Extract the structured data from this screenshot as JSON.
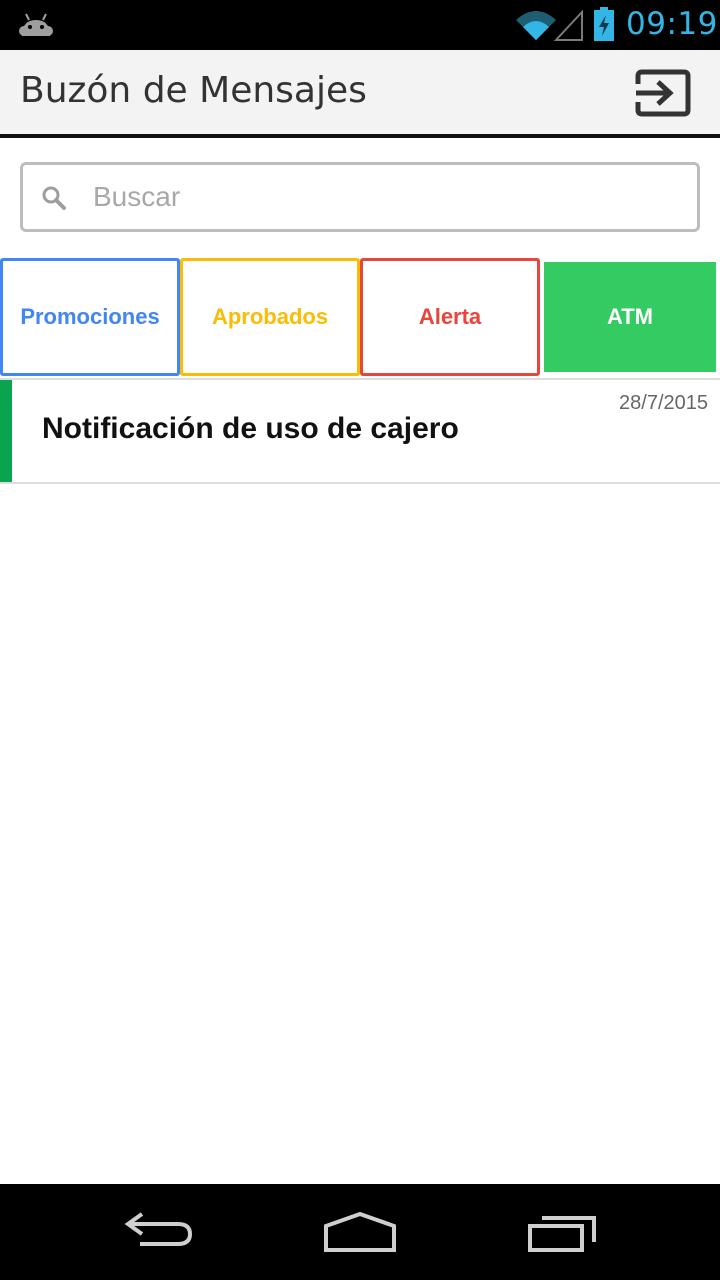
{
  "status_bar": {
    "time": "09:19",
    "clock_color": "#33b5e5",
    "icons": [
      "android-icon",
      "wifi-icon",
      "signal-icon",
      "battery-charging-icon"
    ]
  },
  "app_bar": {
    "title": "Buzón de Mensajes",
    "action_icon": "logout-icon"
  },
  "search": {
    "placeholder": "Buscar",
    "value": "",
    "icon": "search-icon"
  },
  "tabs": [
    {
      "label": "Promociones",
      "color": "#4285f4",
      "selected": false
    },
    {
      "label": "Aprobados",
      "color": "#fbbc05",
      "selected": false
    },
    {
      "label": "Alerta",
      "color": "#e8453c",
      "selected": false
    },
    {
      "label": "ATM",
      "color": "#34cc62",
      "selected": true
    }
  ],
  "messages": [
    {
      "title": "Notificación de uso de cajero",
      "date": "28/7/2015",
      "accent_color": "#0aa34f"
    }
  ],
  "nav_bar": {
    "icons": [
      "back-icon",
      "home-icon",
      "recent-apps-icon"
    ]
  }
}
